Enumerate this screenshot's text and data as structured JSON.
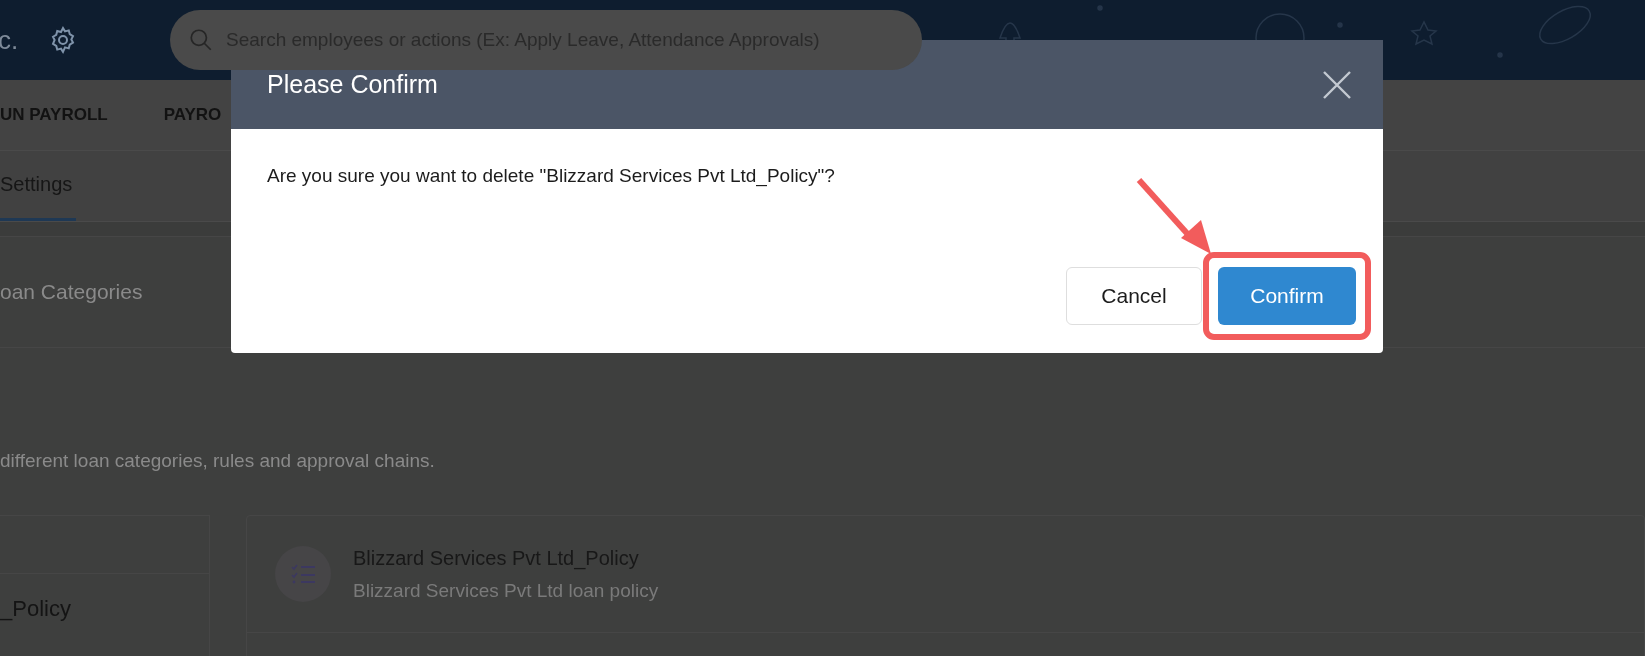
{
  "header": {
    "company_name": "c.",
    "search": {
      "placeholder": "Search employees or actions (Ex: Apply Leave, Attendance Approvals)"
    }
  },
  "nav": {
    "items": [
      {
        "label": "UN PAYROLL"
      },
      {
        "label": "PAYRO"
      }
    ]
  },
  "tabs": [
    {
      "label": "Settings",
      "selected": true
    }
  ],
  "section": {
    "title": "oan Categories",
    "description": "different loan categories, rules and approval chains."
  },
  "sidebar": {
    "items": [
      {
        "label": "_Policy"
      }
    ]
  },
  "policies": [
    {
      "title": "Blizzard Services Pvt Ltd_Policy",
      "subtitle": "Blizzard Services Pvt Ltd loan policy"
    }
  ],
  "dialog": {
    "title": "Please Confirm",
    "message": "Are you sure you want to delete \"Blizzard Services Pvt Ltd_Policy\"?",
    "buttons": [
      {
        "label": "Cancel",
        "kind": "secondary",
        "highlighted": false
      },
      {
        "label": "Confirm",
        "kind": "primary",
        "highlighted": true
      }
    ]
  }
}
